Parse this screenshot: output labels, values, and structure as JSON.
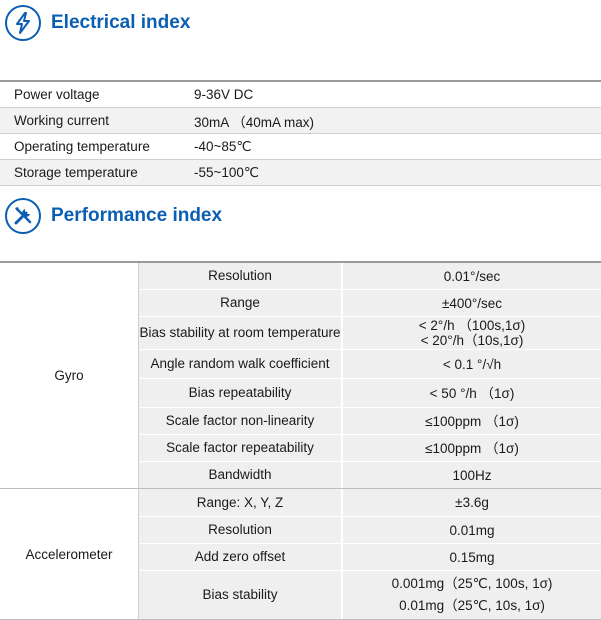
{
  "electrical": {
    "title": "Electrical index",
    "icon": "lightning-icon",
    "rows": [
      {
        "key": "Power voltage",
        "value": "9-36V DC"
      },
      {
        "key": "Working current",
        "value": "30mA （40mA max)"
      },
      {
        "key": "Operating temperature",
        "value": "-40~85℃"
      },
      {
        "key": "Storage temperature",
        "value": "-55~100℃"
      }
    ]
  },
  "performance": {
    "title": "Performance index",
    "icon": "tools-icon",
    "gyro": {
      "label": "Gyro",
      "rows": [
        {
          "name": "Resolution",
          "values": [
            "0.01°/sec"
          ]
        },
        {
          "name": "Range",
          "values": [
            "±400°/sec"
          ]
        },
        {
          "name": "Bias stability at room temperature",
          "values": [
            "< 2°/h （100s,1σ)",
            "< 20°/h（10s,1σ)"
          ]
        },
        {
          "name": "Angle random walk coefficient",
          "values": [
            "< 0.1 °/√h"
          ]
        },
        {
          "name": "Bias repeatability",
          "values": [
            "< 50 °/h （1σ)"
          ]
        },
        {
          "name": "Scale factor non-linearity",
          "values": [
            "≤100ppm （1σ)"
          ]
        },
        {
          "name": "Scale factor repeatability",
          "values": [
            "≤100ppm （1σ)"
          ]
        },
        {
          "name": "Bandwidth",
          "values": [
            "100Hz"
          ]
        }
      ]
    },
    "accelerometer": {
      "label": "Accelerometer",
      "rows": [
        {
          "name": "Range: X, Y, Z",
          "values": [
            "±3.6g"
          ]
        },
        {
          "name": "Resolution",
          "values": [
            "0.01mg"
          ]
        },
        {
          "name": "Add zero offset",
          "values": [
            "0.15mg"
          ]
        },
        {
          "name": "Bias stability",
          "values": [
            "0.001mg（25℃, 100s, 1σ)",
            "0.01mg（25℃, 10s, 1σ)"
          ]
        }
      ]
    }
  },
  "colors": {
    "accent": "#0b5fb3",
    "row_alt": "#f2f2f2",
    "cell": "#efefef"
  }
}
